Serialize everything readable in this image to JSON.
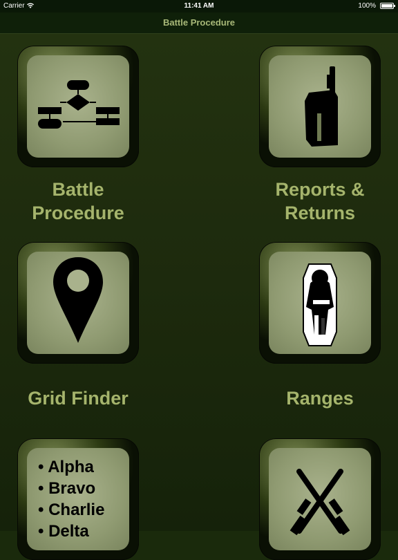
{
  "status_bar": {
    "carrier": "Carrier",
    "time": "11:41 AM",
    "battery_percent": "100%",
    "icons": [
      "wifi-icon",
      "battery-icon"
    ]
  },
  "nav": {
    "title": "Battle Procedure"
  },
  "menu": {
    "items": [
      {
        "label_line1": "Battle",
        "label_line2": "Procedure",
        "icon": "flowchart-icon"
      },
      {
        "label_line1": "Reports &",
        "label_line2": "Returns",
        "icon": "radio-icon"
      },
      {
        "label": "Grid Finder",
        "icon": "map-pin-icon"
      },
      {
        "label": "Ranges",
        "icon": "soldier-target-icon"
      },
      {
        "icon": "phonetic-alphabet-icon",
        "list": [
          "Alpha",
          "Bravo",
          "Charlie",
          "Delta"
        ]
      },
      {
        "icon": "crossed-rifles-icon"
      }
    ]
  },
  "colors": {
    "background": "#1a2a0c",
    "nav_title": "#a8b878",
    "label": "#a5b46c",
    "tile_face": "#9ea783"
  }
}
